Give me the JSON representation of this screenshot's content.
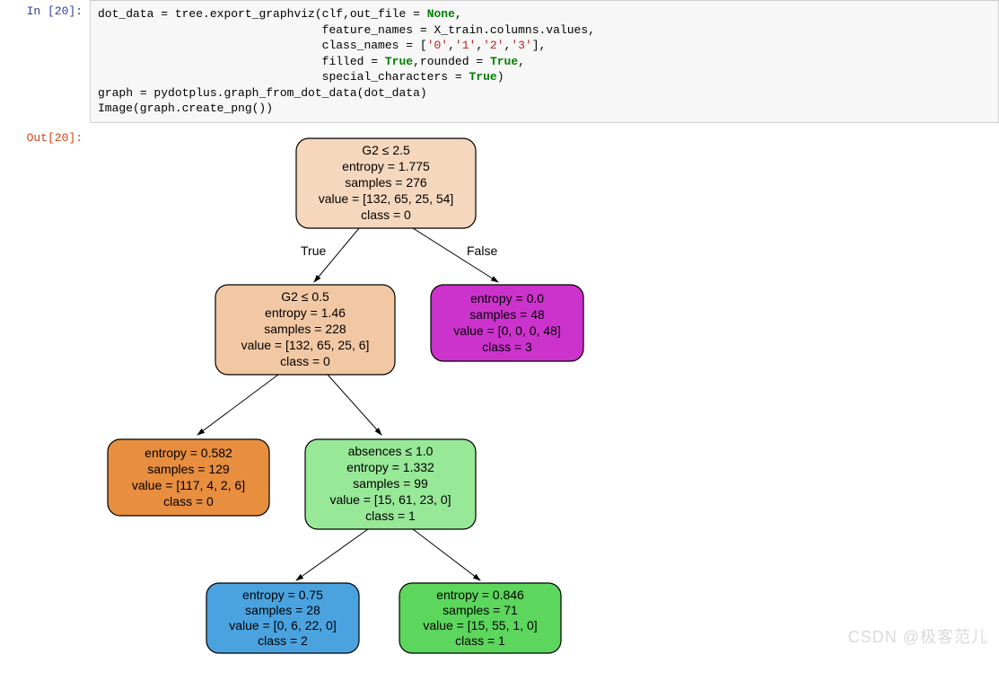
{
  "prompts": {
    "in": "In  [20]:",
    "out": "Out[20]:"
  },
  "code": {
    "l1a": "dot_data ",
    "l1b": " tree.export_graphviz(clf,out_file ",
    "l1c": " ",
    "l1d": ",",
    "l2a": "                                feature_names ",
    "l2b": " X_train.columns.values,",
    "l3a": "                                class_names ",
    "l3b": " [",
    "l3c": ",",
    "l3d": "],",
    "l4a": "                                filled ",
    "l4b": ",rounded ",
    "l4c": ",",
    "l5a": "                                special_characters ",
    "l5b": ")",
    "l6": "graph ",
    "l6b": " pydotplus.graph_from_dot_data(dot_data)",
    "l7": "Image(graph.create_png())",
    "eq": "=",
    "none": "None",
    "true": "True",
    "s0": "'0'",
    "s1": "'1'",
    "s2": "'2'",
    "s3": "'3'"
  },
  "tree": {
    "labels": {
      "true": "True",
      "false": "False"
    },
    "nodes": {
      "root": {
        "l1": "G2 ≤ 2.5",
        "l2": "entropy = 1.775",
        "l3": "samples = 276",
        "l4": "value = [132, 65, 25, 54]",
        "l5": "class = 0",
        "fill": "#f5d7bd"
      },
      "left": {
        "l1": "G2 ≤ 0.5",
        "l2": "entropy = 1.46",
        "l3": "samples = 228",
        "l4": "value = [132, 65, 25, 6]",
        "l5": "class = 0",
        "fill": "#f2c8a4"
      },
      "right": {
        "l1": "entropy = 0.0",
        "l2": "samples = 48",
        "l3": "value = [0, 0, 0, 48]",
        "l4": "class = 3",
        "fill": "#cc33cc"
      },
      "ll": {
        "l1": "entropy = 0.582",
        "l2": "samples = 129",
        "l3": "value = [117, 4, 2, 6]",
        "l4": "class = 0",
        "fill": "#e88e3f"
      },
      "lr": {
        "l1": "absences ≤ 1.0",
        "l2": "entropy = 1.332",
        "l3": "samples = 99",
        "l4": "value = [15, 61, 23, 0]",
        "l5": "class = 1",
        "fill": "#97e897"
      },
      "lrl": {
        "l1": "entropy = 0.75",
        "l2": "samples = 28",
        "l3": "value = [0, 6, 22, 0]",
        "l4": "class = 2",
        "fill": "#4aa3df"
      },
      "lrr": {
        "l1": "entropy = 0.846",
        "l2": "samples = 71",
        "l3": "value = [15, 55, 1, 0]",
        "l4": "class = 1",
        "fill": "#5cd65c"
      }
    }
  },
  "watermark": "CSDN @极客范儿"
}
